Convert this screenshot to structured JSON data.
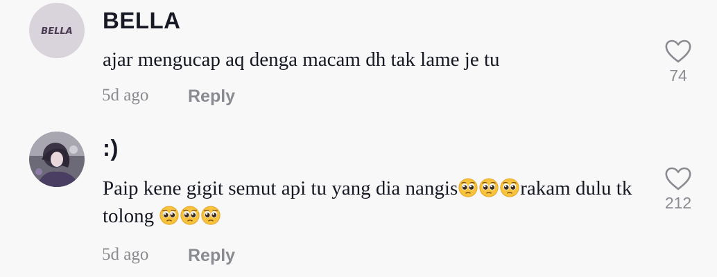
{
  "comments": [
    {
      "username": "BELLA",
      "avatar_text": "BELLA",
      "text": "ajar mengucap aq denga macam dh tak lame je tu",
      "time": "5d ago",
      "reply_label": "Reply",
      "likes": "74"
    },
    {
      "username": ":)",
      "text_part1": "Paip kene gigit semut api tu yang dia nangis",
      "text_part2": "rakam dulu tk tolong ",
      "emoji": "pleading-face",
      "time": "5d ago",
      "reply_label": "Reply",
      "likes": "212"
    }
  ],
  "colors": {
    "background": "#f8f8f8",
    "primary_text": "#161823",
    "secondary_text": "#8a8b91"
  },
  "icons": {
    "like": "heart-outline-icon",
    "emoji": "pleading-face-emoji"
  }
}
